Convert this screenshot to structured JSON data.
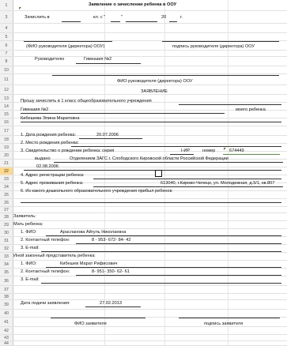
{
  "title": "Заявление о зачислении ребенка в ООУ",
  "r3": {
    "prefix": "Зачислить в",
    "kl": "кл. с \"",
    "quote": "\"",
    "year": "20",
    "g": "г."
  },
  "r6": {
    "left": "(ФИО руководителя (директора) ООУ)",
    "right": "подпись руководителя (директора) ООУ"
  },
  "r8": {
    "label": "Руководителю",
    "value": "Гимназия №2"
  },
  "r11": "ФИО руководителя (директора) ООУ",
  "r12": "ЗАЯВЛЕНИЕ",
  "r13": "Прошу зачислить в 1 класс общеобразовательного учреждения",
  "r14": {
    "value": "Гимназия №2",
    "right": "моего ребенка"
  },
  "r15": "Кибешева Элина Маратовна",
  "r17": {
    "label": "1. Дата рождения ребенка:",
    "value": "20.07.2006"
  },
  "r18": "2. Место рождения ребенка:",
  "r19": {
    "label": "3. Свидетельство о рождении ребенка: серия",
    "series": "I-ИР",
    "num_label": "номер",
    "num": "674449"
  },
  "r20": {
    "label": "выдано",
    "value": "Отделением ЗАГС г. Слободского Кировской области Российской Федерации"
  },
  "r21": "02.08.2006",
  "r22": "4. Адрес регистрации ребенка:",
  "r23": {
    "label": "5. Адрес проживания ребенка:",
    "value": "613040, г.Кирово-Чепецк, ул. Молодежная, д.5/1, кв.807"
  },
  "r24": "6. Из какого дошкольного образовательного учреждения прибыл ребенок:",
  "r28": "Заявитель:",
  "r29": "Мать ребенка:",
  "r30": {
    "label": "1. ФИО:",
    "value": "Арасланова Айгуль Николаевна"
  },
  "r31": {
    "label": "2. Контактный телефон:",
    "value": "8 - 953- 672- 84- 42"
  },
  "r32": "3. E-mail:",
  "r33": "Иной законный представитель ребенка:",
  "r34": {
    "label": "1. ФИО:",
    "value": "Кибешев Марат Рифисович"
  },
  "r35": {
    "label": "2. Контактный телефон:",
    "value": "8- 951- 350- 62- 61"
  },
  "r36": "3. E-mail:",
  "r39": {
    "label": "Дата подачи заявления:",
    "value": "27.02.2013"
  },
  "r42": {
    "left": "ФИО заявителя",
    "right": "подпись заявителя"
  },
  "row_numbers": [
    "1",
    "3",
    "4",
    "5",
    "6",
    "7",
    "8",
    "10",
    "11",
    "12",
    "13",
    "14",
    "15",
    "16",
    "17",
    "18",
    "19",
    "20",
    "21",
    "22",
    "23",
    "24",
    "25",
    "26",
    "27",
    "28",
    "29",
    "30",
    "31",
    "32",
    "33",
    "34",
    "35",
    "36",
    "37",
    "38",
    "39",
    "40",
    "41",
    "42",
    "43",
    "44"
  ],
  "selected_row": "22"
}
